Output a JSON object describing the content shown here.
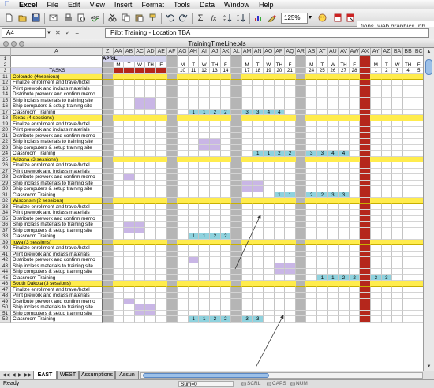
{
  "menubar": {
    "apple": "",
    "items": [
      "Excel",
      "File",
      "Edit",
      "View",
      "Insert",
      "Format",
      "Tools",
      "Data",
      "Window",
      "Help"
    ]
  },
  "toolbar": {
    "zoom": "125%",
    "peek_text": "tions, web graphics, ph"
  },
  "formula_bar": {
    "name_box": "A4",
    "cancel": "✕",
    "enter": "✓",
    "fx": "=",
    "formula": "Pilot Training - Location TBA"
  },
  "window": {
    "title": "TrainingTimeLine.xls"
  },
  "columns": {
    "row_header": "",
    "task_letter": "A",
    "letters": [
      "Z",
      "AA",
      "AB",
      "AC",
      "AD",
      "AE",
      "AF",
      "AG",
      "AH",
      "AI",
      "AJ",
      "AK",
      "AL",
      "AM",
      "AN",
      "AO",
      "AP",
      "AQ",
      "AR",
      "AS",
      "AT",
      "AU",
      "AV",
      "AW",
      "AX",
      "AY",
      "AZ",
      "BA",
      "BB",
      "BC"
    ]
  },
  "header": {
    "month": "APRIL",
    "tasks_label": "TASKS",
    "days": [
      "",
      "M",
      "T",
      "W",
      "TH",
      "F",
      "",
      "M",
      "T",
      "W",
      "TH",
      "F",
      "",
      "M",
      "T",
      "W",
      "TH",
      "F",
      "",
      "M",
      "T",
      "W",
      "TH",
      "F",
      "",
      "M",
      "T",
      "W",
      "TH",
      "F"
    ],
    "dates": [
      "",
      "",
      "",
      "",
      "",
      "",
      "",
      "10",
      "11",
      "12",
      "13",
      "14",
      "",
      "17",
      "18",
      "19",
      "20",
      "21",
      "",
      "24",
      "25",
      "26",
      "27",
      "28",
      "",
      "1",
      "2",
      "3",
      "4",
      "5"
    ]
  },
  "rows": [
    {
      "n": "11",
      "task": "Colorado (4sessions)",
      "section": true
    },
    {
      "n": "12",
      "task": "Finalize enrollment and travel/hotel"
    },
    {
      "n": "13",
      "task": "Print prework and inclass materials"
    },
    {
      "n": "14",
      "task": "Distribute prework and confirm memo"
    },
    {
      "n": "15",
      "task": "Ship inclass materials to training site",
      "blocks": [
        3,
        4
      ]
    },
    {
      "n": "16",
      "task": "Ship computers & setup training site",
      "blocks": [
        3,
        4
      ]
    },
    {
      "n": "17",
      "task": "Classroom Training",
      "train": [
        [
          8,
          "1"
        ],
        [
          9,
          "1"
        ],
        [
          10,
          "2"
        ],
        [
          11,
          "2"
        ],
        [
          13,
          "3"
        ],
        [
          14,
          "3"
        ],
        [
          15,
          "4"
        ],
        [
          16,
          "4"
        ]
      ]
    },
    {
      "n": "18",
      "task": "Texas (4 sessions)",
      "section": true
    },
    {
      "n": "19",
      "task": "Finalize enrollment and travel/hotel"
    },
    {
      "n": "20",
      "task": "Print prework and inclass materials"
    },
    {
      "n": "21",
      "task": "Distribute prework and confirm memo"
    },
    {
      "n": "22",
      "task": "Ship inclass materials to training site",
      "blocks": [
        9,
        10
      ]
    },
    {
      "n": "23",
      "task": "Ship computers & setup training site",
      "blocks": [
        9,
        10
      ]
    },
    {
      "n": "24",
      "task": "Classroom Training",
      "train": [
        [
          14,
          "1"
        ],
        [
          15,
          "1"
        ],
        [
          16,
          "2"
        ],
        [
          17,
          "2"
        ],
        [
          19,
          "3"
        ],
        [
          20,
          "3"
        ],
        [
          21,
          "4"
        ],
        [
          22,
          "4"
        ]
      ]
    },
    {
      "n": "25",
      "task": "Arizona (3 sessions)",
      "section": true
    },
    {
      "n": "26",
      "task": "Finalize enrollment and travel/hotel"
    },
    {
      "n": "27",
      "task": "Print prework and inclass materials"
    },
    {
      "n": "28",
      "task": "Distribute prework and confirm memo",
      "blocks": [
        2
      ]
    },
    {
      "n": "29",
      "task": "Ship inclass materials to training site",
      "blocks": [
        13,
        14
      ]
    },
    {
      "n": "30",
      "task": "Ship computers & setup training site",
      "blocks": [
        13,
        14
      ]
    },
    {
      "n": "31",
      "task": "Classroom Training",
      "train": [
        [
          16,
          "1"
        ],
        [
          17,
          "1"
        ],
        [
          19,
          "2"
        ],
        [
          20,
          "2"
        ],
        [
          21,
          "3"
        ],
        [
          22,
          "3"
        ]
      ]
    },
    {
      "n": "32",
      "task": "Wisconsin (2 sessions)",
      "section": true
    },
    {
      "n": "33",
      "task": "Finalize enrollment and travel/hotel"
    },
    {
      "n": "34",
      "task": "Print prework and inclass materials"
    },
    {
      "n": "35",
      "task": "Distribute prework and confirm memo"
    },
    {
      "n": "36",
      "task": "Ship inclass materials to training site",
      "blocks": [
        2,
        3
      ]
    },
    {
      "n": "37",
      "task": "Ship computers & setup training site",
      "blocks": [
        2,
        3
      ]
    },
    {
      "n": "38",
      "task": "Classroom Training",
      "train": [
        [
          8,
          "1"
        ],
        [
          9,
          "1"
        ],
        [
          10,
          "2"
        ],
        [
          11,
          "2"
        ]
      ]
    },
    {
      "n": "39",
      "task": "Iowa (3 sessions)",
      "section": true
    },
    {
      "n": "40",
      "task": "Finalize enrollment and travel/hotel"
    },
    {
      "n": "41",
      "task": "Print prework and inclass materials"
    },
    {
      "n": "42",
      "task": "Distribute prework and confirm memo",
      "blocks": [
        8
      ]
    },
    {
      "n": "43",
      "task": "Ship inclass materials to training site",
      "blocks": [
        16,
        17
      ]
    },
    {
      "n": "44",
      "task": "Ship computers & setup training site",
      "blocks": [
        16,
        17
      ]
    },
    {
      "n": "45",
      "task": "Classroom Training",
      "train": [
        [
          20,
          "1"
        ],
        [
          21,
          "1"
        ],
        [
          22,
          "2"
        ],
        [
          23,
          "2"
        ],
        [
          25,
          "3"
        ],
        [
          26,
          "3"
        ]
      ]
    },
    {
      "n": "46",
      "task": "South Dakota (3 sessions)",
      "section": true
    },
    {
      "n": "47",
      "task": "Finalize enrollment and travel/hotel"
    },
    {
      "n": "48",
      "task": "Print prework and inclass materials"
    },
    {
      "n": "49",
      "task": "Distribute prework and confirm memo",
      "blocks": [
        2
      ]
    },
    {
      "n": "50",
      "task": "Ship inclass materials to training site",
      "blocks": [
        3,
        4
      ]
    },
    {
      "n": "51",
      "task": "Ship computers & setup training site",
      "blocks": [
        3,
        4
      ]
    },
    {
      "n": "52",
      "task": "Classroom Training",
      "train": [
        [
          8,
          "1"
        ],
        [
          9,
          "1"
        ],
        [
          10,
          "2"
        ],
        [
          11,
          "2"
        ],
        [
          13,
          "3"
        ],
        [
          14,
          "3"
        ]
      ]
    }
  ],
  "tabs": [
    "EAST",
    "WEST",
    "Assumptions",
    "Assun"
  ],
  "status": {
    "ready": "Ready",
    "sum": "Sum=0",
    "indicators": [
      "SCRL",
      "CAPS",
      "NUM"
    ]
  }
}
